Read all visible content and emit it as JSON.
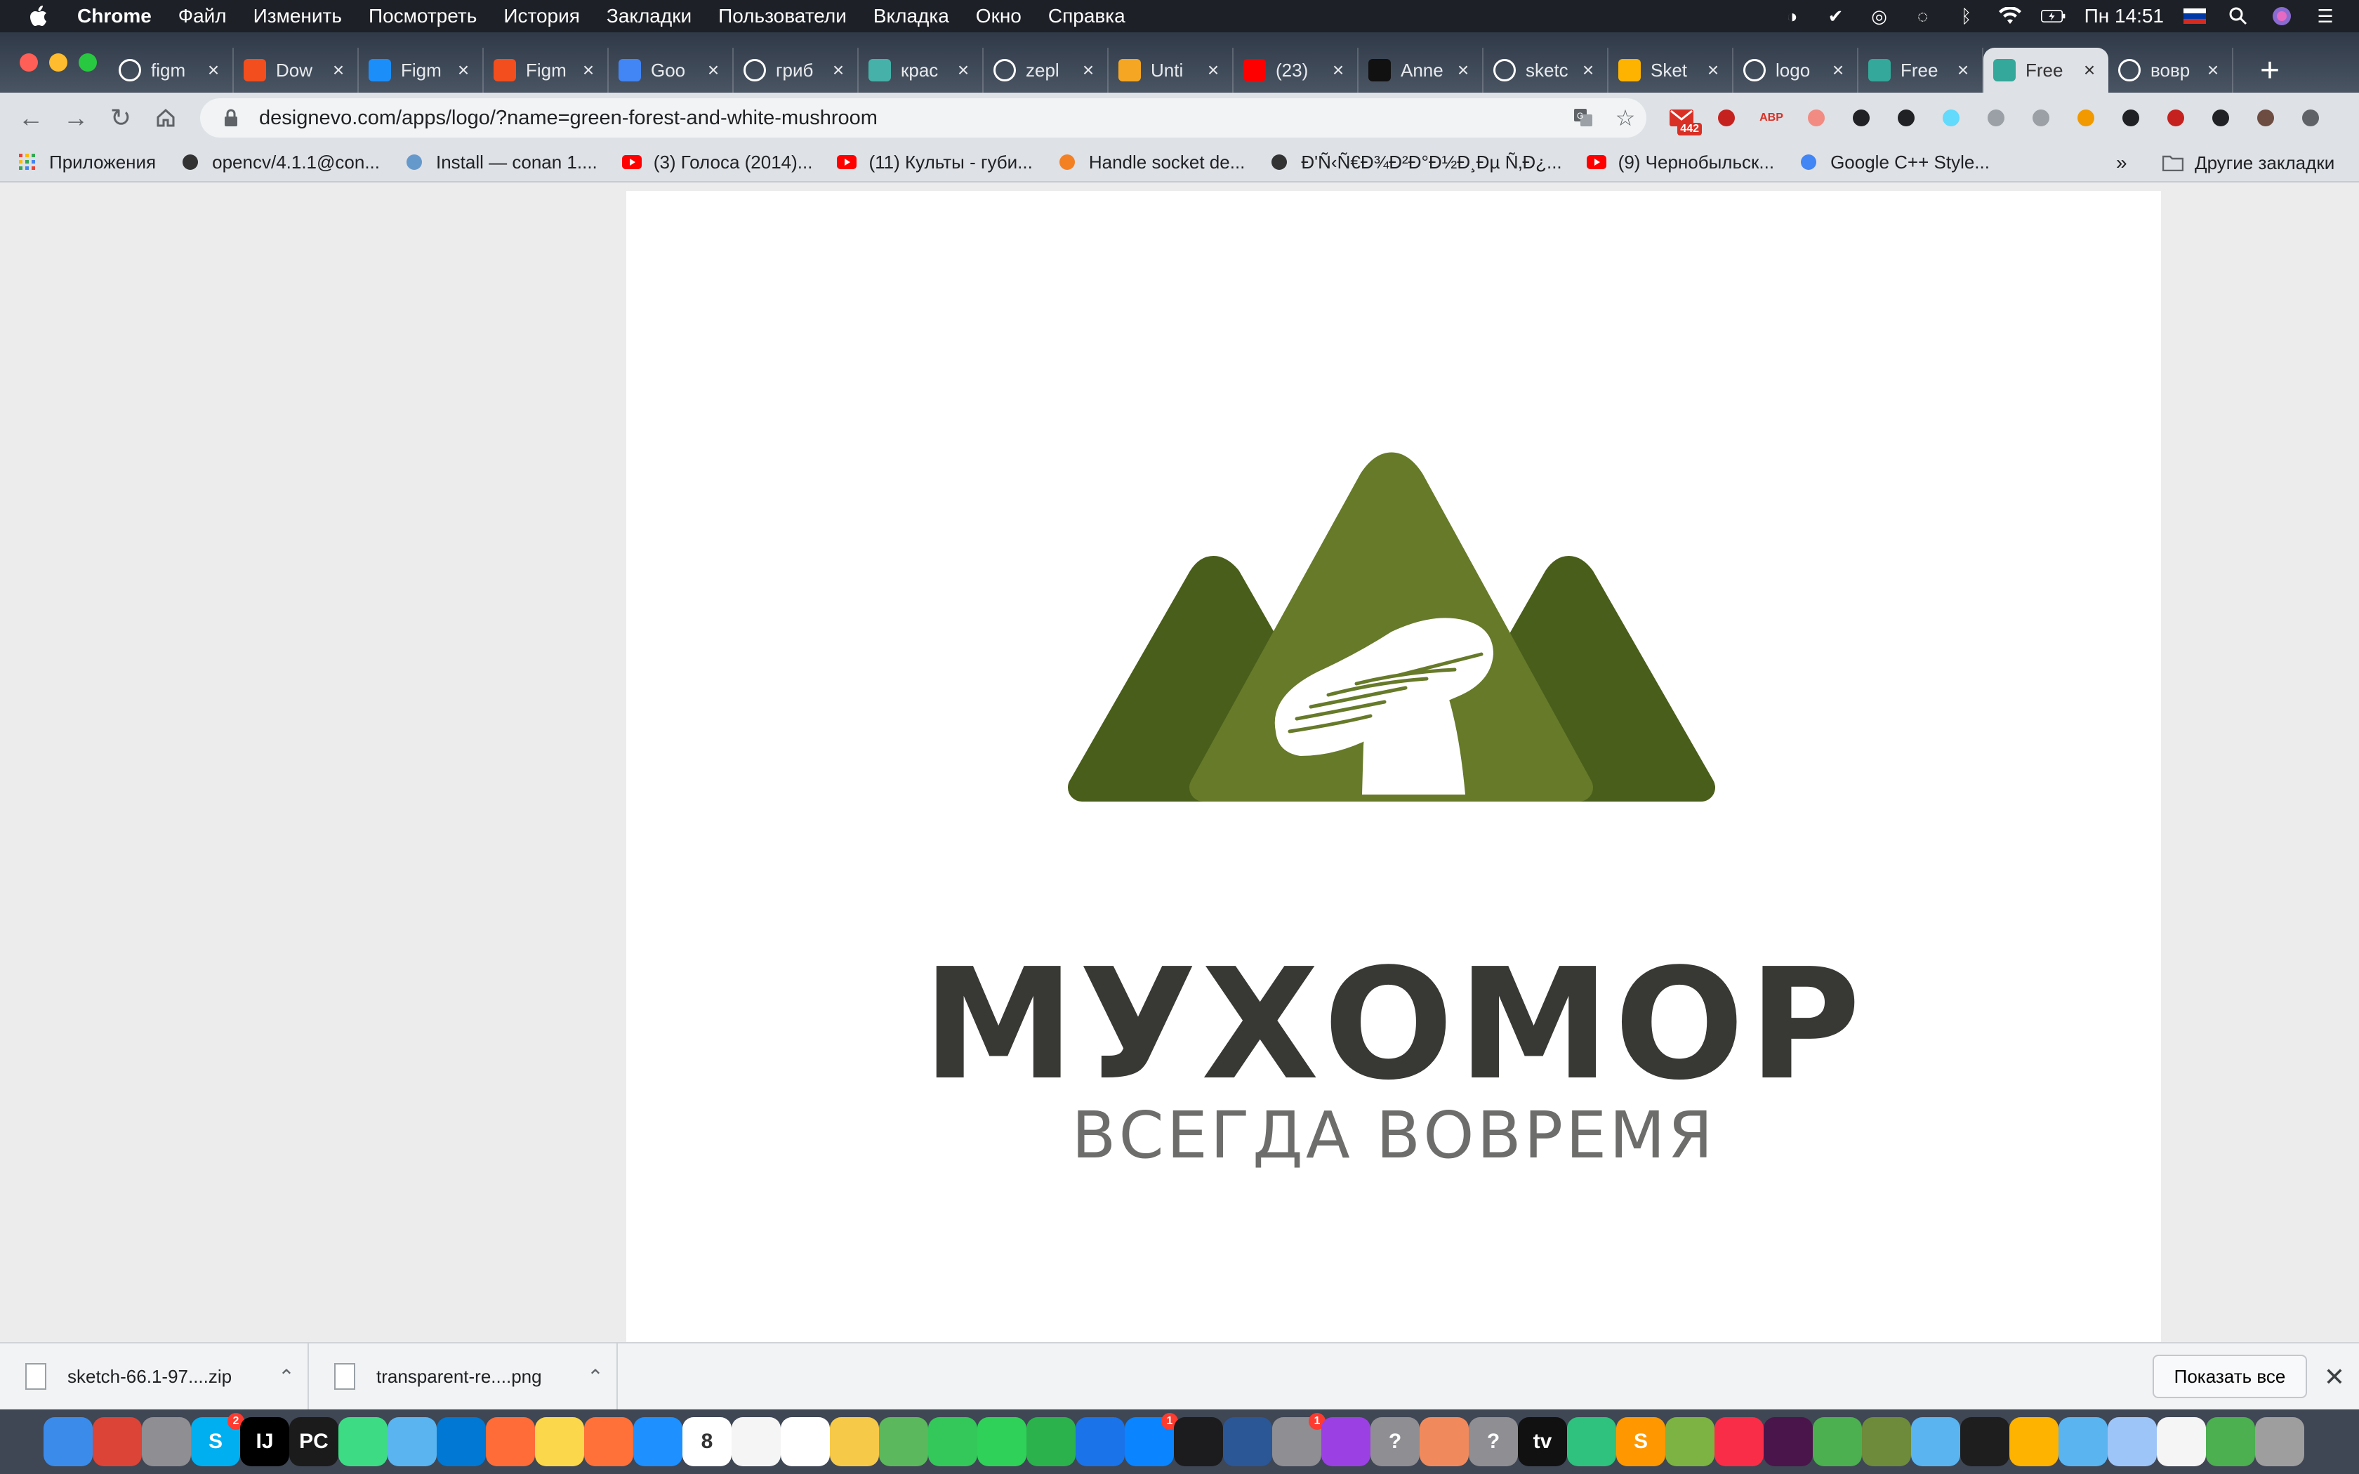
{
  "menubar": {
    "app_name": "Chrome",
    "items": [
      "Файл",
      "Изменить",
      "Посмотреть",
      "История",
      "Закладки",
      "Пользователи",
      "Вкладка",
      "Окно",
      "Справка"
    ],
    "clock": "Пн 14:51"
  },
  "tabs": [
    {
      "title": "figm",
      "favicon": "google-icon",
      "color": "#ffffff"
    },
    {
      "title": "Dow",
      "favicon": "figma-icon",
      "color": "#f24e1e"
    },
    {
      "title": "Figm",
      "favicon": "app-store-icon",
      "color": "#1c8ef9"
    },
    {
      "title": "Figm",
      "favicon": "figma-icon",
      "color": "#f24e1e"
    },
    {
      "title": "Goo",
      "favicon": "google-translate-icon",
      "color": "#4285f4"
    },
    {
      "title": "гриб",
      "favicon": "google-icon",
      "color": "#ffffff"
    },
    {
      "title": "крас",
      "favicon": "png-icon",
      "color": "#46b1a8"
    },
    {
      "title": "zepl",
      "favicon": "google-icon",
      "color": "#ffffff"
    },
    {
      "title": "Unti",
      "favicon": "tab-icon",
      "color": "#f5a623"
    },
    {
      "title": "(23)",
      "favicon": "youtube-icon",
      "color": "#ff0000"
    },
    {
      "title": "Anne",
      "favicon": "medium-icon",
      "color": "#111111"
    },
    {
      "title": "sketc",
      "favicon": "google-icon",
      "color": "#ffffff"
    },
    {
      "title": "Sket",
      "favicon": "sketch-icon",
      "color": "#fdb300"
    },
    {
      "title": "logo",
      "favicon": "google-icon",
      "color": "#ffffff"
    },
    {
      "title": "Free",
      "favicon": "designevo-icon",
      "color": "#34a89a"
    },
    {
      "title": "Free",
      "favicon": "designevo-icon",
      "color": "#34a89a",
      "active": true
    },
    {
      "title": "вовр",
      "favicon": "google-icon",
      "color": "#ffffff"
    }
  ],
  "toolbar": {
    "url": "designevo.com/apps/logo/?name=green-forest-and-white-mushroom",
    "extensions": [
      {
        "icon": "gmail-icon",
        "badge": "442",
        "color": "#d93025"
      },
      {
        "icon": "ublock-icon",
        "color": "#c5221f"
      },
      {
        "icon": "adblock-plus-icon",
        "label": "ABP",
        "color": "#d93025"
      },
      {
        "icon": "pdf-icon",
        "color": "#f28b82"
      },
      {
        "icon": "extension-icon",
        "color": "#202124"
      },
      {
        "icon": "extension-icon",
        "color": "#202124"
      },
      {
        "icon": "react-icon",
        "color": "#61dafb"
      },
      {
        "icon": "extension-icon",
        "color": "#9aa0a6"
      },
      {
        "icon": "extension-icon",
        "color": "#9aa0a6"
      },
      {
        "icon": "extension-icon",
        "color": "#f29900"
      },
      {
        "icon": "extension-icon",
        "color": "#202124"
      },
      {
        "icon": "extension-icon",
        "color": "#c5221f"
      },
      {
        "icon": "media-icon",
        "color": "#202124"
      },
      {
        "icon": "avatar-icon",
        "color": "#6d4c41"
      },
      {
        "icon": "kebab-menu-icon",
        "color": "#5f6368"
      }
    ]
  },
  "bookmarks": {
    "items": [
      {
        "label": "Приложения",
        "icon": "apps-grid-icon"
      },
      {
        "label": "opencv/4.1.1@con...",
        "icon": "github-icon"
      },
      {
        "label": "Install — conan 1....",
        "icon": "conan-icon"
      },
      {
        "label": "(3) Голоса (2014)...",
        "icon": "youtube-icon"
      },
      {
        "label": "(11) Культы - губи...",
        "icon": "youtube-icon"
      },
      {
        "label": "Handle socket de...",
        "icon": "stackoverflow-icon"
      },
      {
        "label": "Ð'Ñ‹Ñ€Ð¾Ð²Ð°Ð½Ð¸Ðµ Ñ‚Ð¿...",
        "icon": "globe-icon"
      },
      {
        "label": "(9) Чернобыльск...",
        "icon": "youtube-icon"
      },
      {
        "label": "Google C++ Style...",
        "icon": "google-icon"
      }
    ],
    "more": "»",
    "other": "Другие закладки"
  },
  "logo": {
    "title": "МУХОМОР",
    "slogan": "ВСЕГДА ВОВРЕМЯ",
    "colors": {
      "dark_green": "#4a5e1b",
      "mid_green": "#5b7223",
      "light_green": "#667a2a",
      "title_color": "#383834",
      "slogan_color": "#6d6d6b"
    }
  },
  "downloads": {
    "items": [
      {
        "name": "sketch-66.1-97....zip"
      },
      {
        "name": "transparent-re....png"
      }
    ],
    "show_all": "Показать все"
  },
  "dock": {
    "apps": [
      {
        "name": "finder-icon",
        "color": "#3b8beb"
      },
      {
        "name": "chrome-icon",
        "color": "#db4437"
      },
      {
        "name": "rocket-icon",
        "color": "#8e8e93"
      },
      {
        "name": "skype-icon",
        "color": "#00aff0",
        "label": "S",
        "badge": "2"
      },
      {
        "name": "intellij-icon",
        "color": "#000000",
        "label": "IJ"
      },
      {
        "name": "pycharm-icon",
        "color": "#1b1b1b",
        "label": "PC"
      },
      {
        "name": "android-studio-icon",
        "color": "#3ddc84"
      },
      {
        "name": "folder-icon",
        "color": "#5ab4f0"
      },
      {
        "name": "vscode-icon",
        "color": "#0078d4"
      },
      {
        "name": "postman-icon",
        "color": "#ff6c37"
      },
      {
        "name": "notes-icon",
        "color": "#fbd74b"
      },
      {
        "name": "firefox-icon",
        "color": "#ff7139"
      },
      {
        "name": "safari-icon",
        "color": "#1e90ff"
      },
      {
        "name": "calendar-icon",
        "color": "#ffffff",
        "label": "8"
      },
      {
        "name": "textedit-icon",
        "color": "#f5f5f5"
      },
      {
        "name": "reminders-icon",
        "color": "#ffffff"
      },
      {
        "name": "photos-icon",
        "color": "#f7c948"
      },
      {
        "name": "maps-icon",
        "color": "#5cb85c"
      },
      {
        "name": "messages-icon",
        "color": "#34c759"
      },
      {
        "name": "facetime-icon",
        "color": "#30d158"
      },
      {
        "name": "numbers-icon",
        "color": "#2bb24c"
      },
      {
        "name": "keynote-icon",
        "color": "#1a73e8"
      },
      {
        "name": "app-store-icon",
        "color": "#0a84ff",
        "badge": "1"
      },
      {
        "name": "terminal-icon",
        "color": "#1c1c1e"
      },
      {
        "name": "sourcetree-icon",
        "color": "#2b5797"
      },
      {
        "name": "system-preferences-icon",
        "color": "#8e8e93",
        "badge": "1"
      },
      {
        "name": "podcasts-icon",
        "color": "#9b41e3"
      },
      {
        "name": "help-icon",
        "color": "#8e8e93",
        "label": "?"
      },
      {
        "name": "sketch-pen-icon",
        "color": "#f08a5d"
      },
      {
        "name": "help-icon",
        "color": "#8e8e93",
        "label": "?"
      },
      {
        "name": "apple-tv-icon",
        "color": "#111111",
        "label": "tv"
      },
      {
        "name": "activity-icon",
        "color": "#2ec27e"
      },
      {
        "name": "sublime-icon",
        "color": "#ff9800",
        "label": "S"
      },
      {
        "name": "cube-icon",
        "color": "#7cb342"
      },
      {
        "name": "music-icon",
        "color": "#fa2d48"
      },
      {
        "name": "slack-icon",
        "color": "#4a154b"
      },
      {
        "name": "mountain-app-icon",
        "color": "#4caf50"
      },
      {
        "name": "minecraft-icon",
        "color": "#6d8b3a"
      },
      {
        "name": "folder-icon",
        "color": "#5ab4f0"
      },
      {
        "name": "figma-icon",
        "color": "#1e1e1e"
      },
      {
        "name": "sketch-icon",
        "color": "#fdb300"
      },
      {
        "name": "downloads-icon",
        "color": "#5ab4f0"
      },
      {
        "name": "screens-icon",
        "color": "#9ec5f8"
      },
      {
        "name": "preview-icon",
        "color": "#f5f5f5"
      },
      {
        "name": "folder-green-icon",
        "color": "#4caf50"
      },
      {
        "name": "trash-icon",
        "color": "#9e9e9e"
      }
    ]
  }
}
